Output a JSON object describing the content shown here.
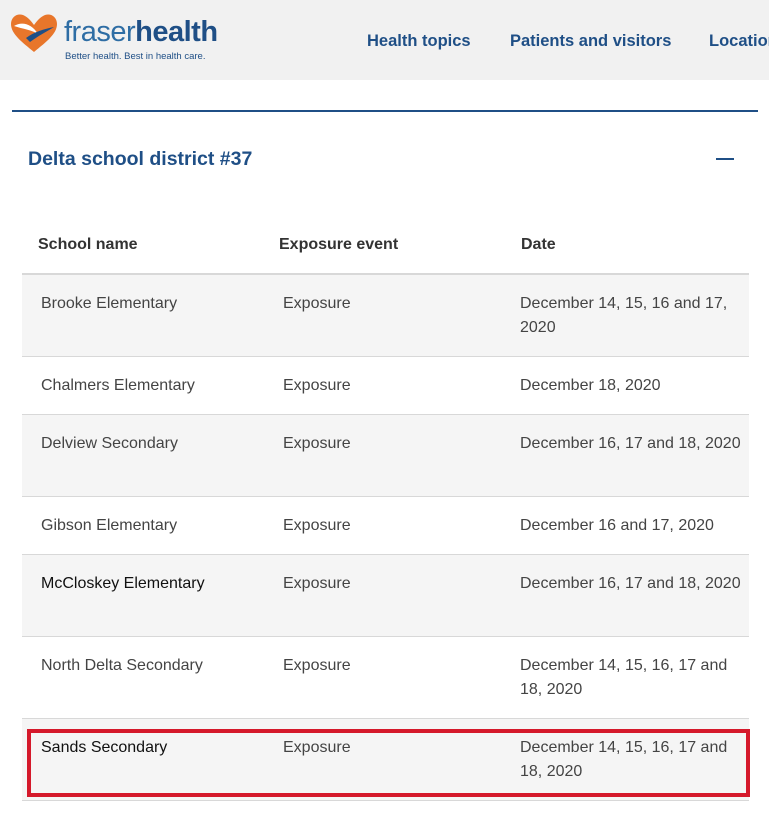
{
  "brand": {
    "name_part1": "fraser",
    "name_part2": "health",
    "tagline": "Better health. Best in health care.",
    "colors": {
      "blue": "#1f4f86",
      "orange": "#e8762b",
      "highlight": "#d5192b"
    }
  },
  "nav": {
    "items": [
      "Health topics",
      "Patients and visitors",
      "Locations"
    ]
  },
  "accordion": {
    "title": "Delta school district #37",
    "toggle_icon": "minus-icon"
  },
  "table": {
    "headers": [
      "School name",
      "Exposure event",
      "Date"
    ],
    "rows": [
      {
        "school": "Brooke Elementary",
        "event": "Exposure",
        "date": "December 14, 15, 16 and 17, 2020"
      },
      {
        "school": "Chalmers Elementary",
        "event": "Exposure",
        "date": "December 18, 2020"
      },
      {
        "school": "Delview Secondary",
        "event": "Exposure",
        "date": "December 16, 17 and 18, 2020"
      },
      {
        "school": "Gibson Elementary",
        "event": "Exposure",
        "date": "December 16 and 17, 2020"
      },
      {
        "school": "McCloskey Elementary",
        "event": "Exposure",
        "date": "December 16, 17 and 18, 2020"
      },
      {
        "school": "North Delta Secondary",
        "event": "Exposure",
        "date": "December 14, 15, 16, 17 and 18, 2020"
      },
      {
        "school": "Sands Secondary",
        "event": "Exposure",
        "date": "December 14, 15, 16, 17 and 18, 2020"
      }
    ]
  }
}
